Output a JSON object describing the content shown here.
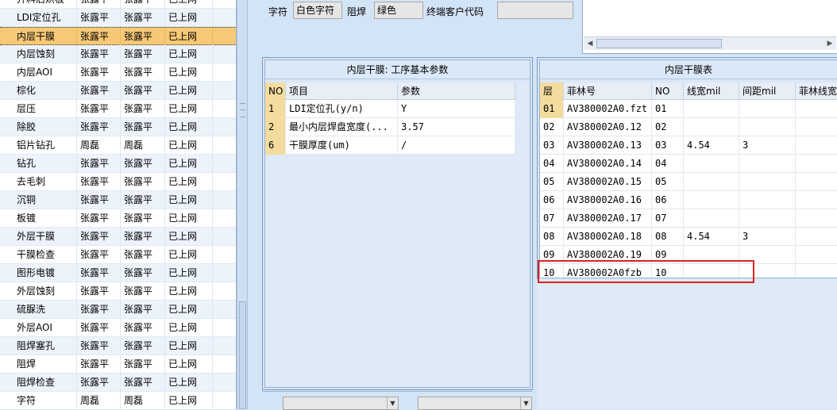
{
  "left_list": {
    "selected_index": 2,
    "rows": [
      [
        "开料后烘板",
        "张露平",
        "张露平",
        "已上网"
      ],
      [
        "LDI定位孔",
        "张露平",
        "张露平",
        "已上网"
      ],
      [
        "内层干膜",
        "张露平",
        "张露平",
        "已上网"
      ],
      [
        "内层蚀刻",
        "张露平",
        "张露平",
        "已上网"
      ],
      [
        "内层AOI",
        "张露平",
        "张露平",
        "已上网"
      ],
      [
        "棕化",
        "张露平",
        "张露平",
        "已上网"
      ],
      [
        "层压",
        "张露平",
        "张露平",
        "已上网"
      ],
      [
        "除胶",
        "张露平",
        "张露平",
        "已上网"
      ],
      [
        "铝片钻孔",
        "周磊",
        "周磊",
        "已上网"
      ],
      [
        "钻孔",
        "张露平",
        "张露平",
        "已上网"
      ],
      [
        "去毛刺",
        "张露平",
        "张露平",
        "已上网"
      ],
      [
        "沉铜",
        "张露平",
        "张露平",
        "已上网"
      ],
      [
        "板镀",
        "张露平",
        "张露平",
        "已上网"
      ],
      [
        "外层干膜",
        "张露平",
        "张露平",
        "已上网"
      ],
      [
        "干膜检查",
        "张露平",
        "张露平",
        "已上网"
      ],
      [
        "图形电镀",
        "张露平",
        "张露平",
        "已上网"
      ],
      [
        "外层蚀刻",
        "张露平",
        "张露平",
        "已上网"
      ],
      [
        "硫脲洗",
        "张露平",
        "张露平",
        "已上网"
      ],
      [
        "外层AOI",
        "张露平",
        "张露平",
        "已上网"
      ],
      [
        "阻焊塞孔",
        "张露平",
        "张露平",
        "已上网"
      ],
      [
        "阻焊",
        "张露平",
        "张露平",
        "已上网"
      ],
      [
        "阻焊检查",
        "张露平",
        "张露平",
        "已上网"
      ],
      [
        "字符",
        "周磊",
        "周磊",
        "已上网"
      ]
    ]
  },
  "top_fields": {
    "char_label": "字符",
    "char_value": "白色字符",
    "mask_label": "阻焊",
    "mask_value": "绿色",
    "customer_code_label": "终端客户代码",
    "customer_code_value": ""
  },
  "params_panel": {
    "title": "内层干膜: 工序基本参数",
    "headers": [
      "NO",
      "项目",
      "参数"
    ],
    "rows": [
      [
        "1",
        "LDI定位孔(y/n)",
        "Y"
      ],
      [
        "2",
        "最小内层焊盘宽度(...",
        "3.57"
      ],
      [
        "6",
        "干膜厚度(um)",
        "/"
      ]
    ]
  },
  "film_panel": {
    "title": "内层干膜表",
    "headers": [
      "层",
      "菲林号",
      "NO",
      "线宽mil",
      "间距mil",
      "菲林线宽"
    ],
    "rows": [
      [
        "01",
        "AV380002A0.fzt",
        "01",
        "",
        "",
        ""
      ],
      [
        "02",
        "AV380002A0.12",
        "02",
        "",
        "",
        ""
      ],
      [
        "03",
        "AV380002A0.13",
        "03",
        "4.54",
        "3",
        ""
      ],
      [
        "04",
        "AV380002A0.14",
        "04",
        "",
        "",
        ""
      ],
      [
        "05",
        "AV380002A0.15",
        "05",
        "",
        "",
        ""
      ],
      [
        "06",
        "AV380002A0.16",
        "06",
        "",
        "",
        ""
      ],
      [
        "07",
        "AV380002A0.17",
        "07",
        "",
        "",
        ""
      ],
      [
        "08",
        "AV380002A0.18",
        "08",
        "4.54",
        "3",
        ""
      ],
      [
        "09",
        "AV380002A0.19",
        "09",
        "",
        "",
        ""
      ],
      [
        "10",
        "AV380002A0fzb",
        "10",
        "",
        "",
        ""
      ]
    ]
  },
  "icons": {
    "dropdown": "chevron-down-icon",
    "scroll_left": "arrow-left-icon",
    "scroll_right": "arrow-right-icon"
  },
  "colors": {
    "selected_row": "#f7c976",
    "highlight_box": "#e02020",
    "header_highlight": "#f3dc9e"
  }
}
